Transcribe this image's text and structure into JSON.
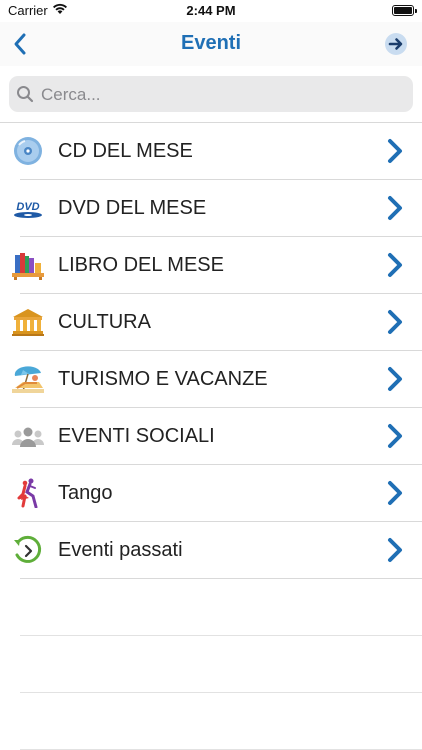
{
  "status_bar": {
    "carrier": "Carrier",
    "time": "2:44 PM"
  },
  "nav": {
    "title": "Eventi",
    "back_icon": "chevron-left-icon",
    "forward_icon": "arrow-right-circle-icon",
    "accent_color": "#1f6fb5"
  },
  "search": {
    "placeholder": "Cerca..."
  },
  "list": {
    "items": [
      {
        "label": "CD DEL MESE",
        "icon": "cd-icon"
      },
      {
        "label": "DVD DEL MESE",
        "icon": "dvd-icon"
      },
      {
        "label": "LIBRO DEL MESE",
        "icon": "books-icon"
      },
      {
        "label": "CULTURA",
        "icon": "museum-icon"
      },
      {
        "label": "TURISMO E VACANZE",
        "icon": "beach-icon"
      },
      {
        "label": "EVENTI SOCIALI",
        "icon": "people-icon"
      },
      {
        "label": "Tango",
        "icon": "dancers-icon"
      },
      {
        "label": "Eventi passati",
        "icon": "history-icon"
      }
    ]
  },
  "colors": {
    "chevron": "#1f6fb5",
    "separator": "#d9d9d9"
  }
}
